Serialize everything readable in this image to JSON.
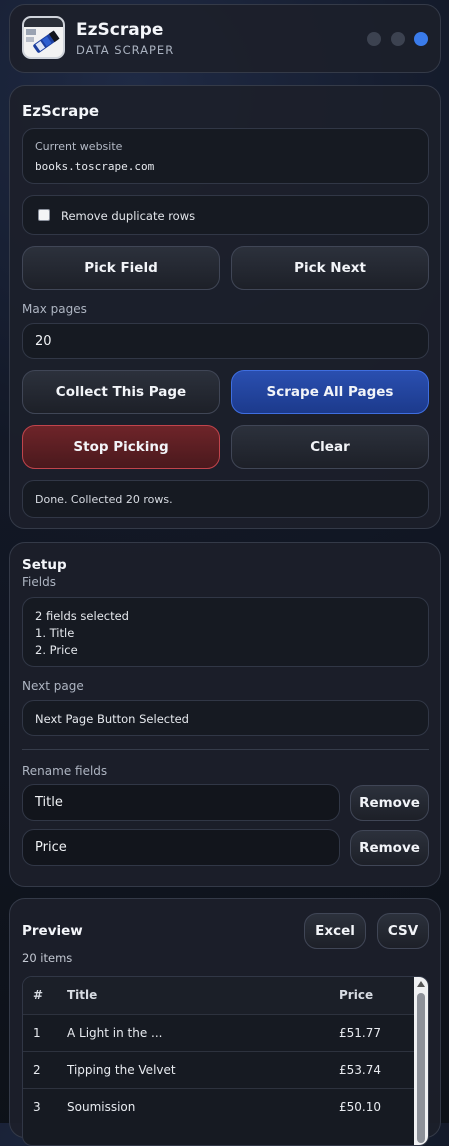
{
  "header": {
    "title": "EzScrape",
    "subtitle": "DATA SCRAPER"
  },
  "main": {
    "title": "EzScrape",
    "current_website_label": "Current website",
    "current_website_value": "books.toscrape.com",
    "remove_duplicates_label": "Remove duplicate rows",
    "remove_duplicates_checked": false,
    "pick_field": "Pick Field",
    "pick_next": "Pick Next",
    "max_pages_label": "Max pages",
    "max_pages_value": "20",
    "collect_page": "Collect This Page",
    "scrape_all": "Scrape All Pages",
    "stop_picking": "Stop Picking",
    "clear": "Clear",
    "status": "Done. Collected 20 rows."
  },
  "setup": {
    "title": "Setup",
    "fields_label": "Fields",
    "fields_summary": "2 fields selected",
    "fields_list": [
      "1. Title",
      "2. Price"
    ],
    "next_page_label": "Next page",
    "next_page_value": "Next Page Button Selected",
    "rename_label": "Rename fields",
    "rename_fields": [
      {
        "value": "Title",
        "remove": "Remove"
      },
      {
        "value": "Price",
        "remove": "Remove"
      }
    ]
  },
  "preview": {
    "title": "Preview",
    "count": "20 items",
    "excel": "Excel",
    "csv": "CSV",
    "columns": [
      "#",
      "Title",
      "Price"
    ],
    "rows": [
      [
        "1",
        "A Light in the ...",
        "£51.77"
      ],
      [
        "2",
        "Tipping the Velvet",
        "£53.74"
      ],
      [
        "3",
        "Soumission",
        "£50.10"
      ]
    ]
  },
  "colors": {
    "accent": "#3a7bea",
    "danger": "#c0444c"
  }
}
